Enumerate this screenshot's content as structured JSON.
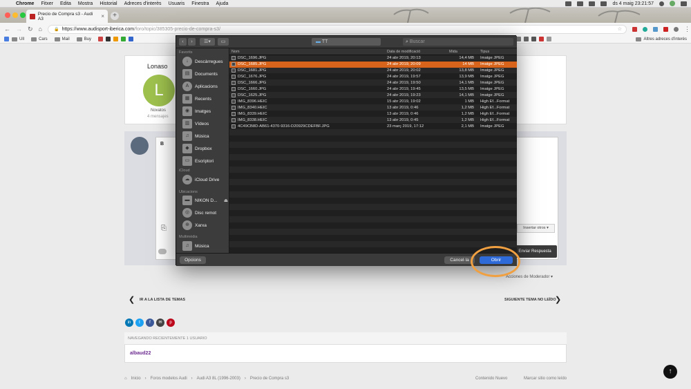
{
  "menubar": {
    "app": "Chrome",
    "items": [
      "Fitxer",
      "Edita",
      "Mostra",
      "Historial",
      "Adreces d'interès",
      "Usuaris",
      "Finestra",
      "Ajuda"
    ],
    "clock": "ds 4 maig  23:21:57"
  },
  "browser": {
    "tab_title": "Precio de Compra s3 - Audi A3",
    "url_host": "https://www.audisport-iberica.com",
    "url_path": "/foro/topic/385305-precio-de-compra-s3/",
    "bookmarks": [
      "Ull",
      "Cars",
      "Mail",
      "Buy"
    ],
    "other_bookmarks": "Altres adreces d'interès"
  },
  "post": {
    "author": "Lonaso",
    "avatar_letter": "L",
    "rank": "Novatos",
    "messages": "4 mensajes"
  },
  "editor": {
    "bold": "B",
    "insert_others": "Insertar otros ▾",
    "submit": "Enviar Respuesta",
    "moderator_actions": "Acciones de Moderador ▾"
  },
  "dialog": {
    "folder": "TT",
    "search_placeholder": "Buscar",
    "sidebar": {
      "favorites_header": "Favorits",
      "favorites": [
        "Descàrregues",
        "Documents",
        "Aplicacions",
        "Recents",
        "Imatges",
        "Vídeos",
        "Música",
        "Dropbox",
        "Escriptori"
      ],
      "icloud_header": "iCloud",
      "icloud": [
        "iCloud Drive"
      ],
      "locations_header": "Ubicacions",
      "locations": [
        "NIKON D...",
        "Disc remot",
        "Xarxa"
      ],
      "multimedia_header": "Multimèdia",
      "multimedia": [
        "Música"
      ]
    },
    "columns": {
      "name": "Nom",
      "date": "Data de modificació",
      "size": "Mida",
      "kind": "Tipus"
    },
    "files": [
      {
        "name": "DSC_1696.JPG",
        "date": "24 abr 2019, 20:13",
        "size": "14,4 MB",
        "kind": "Imatge JPEG"
      },
      {
        "name": "DSC_1685.JPG",
        "date": "24 abr 2019, 20:09",
        "size": "14 MB",
        "kind": "Imatge JPEG"
      },
      {
        "name": "DSC_1681.JPG",
        "date": "24 abr 2019, 20:02",
        "size": "13,8 MB",
        "kind": "Imatge JPEG"
      },
      {
        "name": "DSC_1676.JPG",
        "date": "24 abr 2019, 19:57",
        "size": "13,9 MB",
        "kind": "Imatge JPEG"
      },
      {
        "name": "DSC_1666.JPG",
        "date": "24 abr 2019, 19:50",
        "size": "14,1 MB",
        "kind": "Imatge JPEG"
      },
      {
        "name": "DSC_1660.JPG",
        "date": "24 abr 2019, 19:45",
        "size": "13,5 MB",
        "kind": "Imatge JPEG"
      },
      {
        "name": "DSC_1625.JPG",
        "date": "24 abr 2019, 19:23",
        "size": "14,1 MB",
        "kind": "Imatge JPEG"
      },
      {
        "name": "IMG_8396.HEIC",
        "date": "15 abr 2019, 19:02",
        "size": "1 MB",
        "kind": "High Ef...Format"
      },
      {
        "name": "IMG_8340.HEIC",
        "date": "13 abr 2019, 0:46",
        "size": "1,2 MB",
        "kind": "High Ef...Format"
      },
      {
        "name": "IMG_8339.HEIC",
        "date": "13 abr 2019, 0:46",
        "size": "1,2 MB",
        "kind": "High Ef...Format"
      },
      {
        "name": "IMG_8338.HEIC",
        "date": "13 abr 2019, 0:45",
        "size": "1,2 MB",
        "kind": "High Ef...Format"
      },
      {
        "name": "4C49CB8D-AB61-4370-9316-D20929CDEFBF.JPG",
        "date": "23 març 2019, 17:12",
        "size": "2,1 MB",
        "kind": "Imatge JPEG"
      }
    ],
    "selected_index": 1,
    "options": "Opcions",
    "cancel": "Cancel·la",
    "open": "Obrir"
  },
  "nav": {
    "back": "IR A LA LISTA DE TEMAS",
    "next": "SIGUIENTE TEMA NO LEÍDO"
  },
  "recent": {
    "header": "NAVEGANDO RECIENTEMENTE   1 USUARIO",
    "user": "albaud22"
  },
  "breadcrumb": [
    "Inicio",
    "Foros modelos Audi",
    "Audi A3 8L (1996-2003)",
    "Precio de Compra s3"
  ],
  "footer_links": [
    "Contenido Nuevo",
    "Marcar sitio como leído"
  ],
  "colors": {
    "selection": "#d7641a",
    "open_button": "#2f6bd8",
    "highlight_circle": "#f0a040",
    "avatar": "#9ec14e"
  }
}
